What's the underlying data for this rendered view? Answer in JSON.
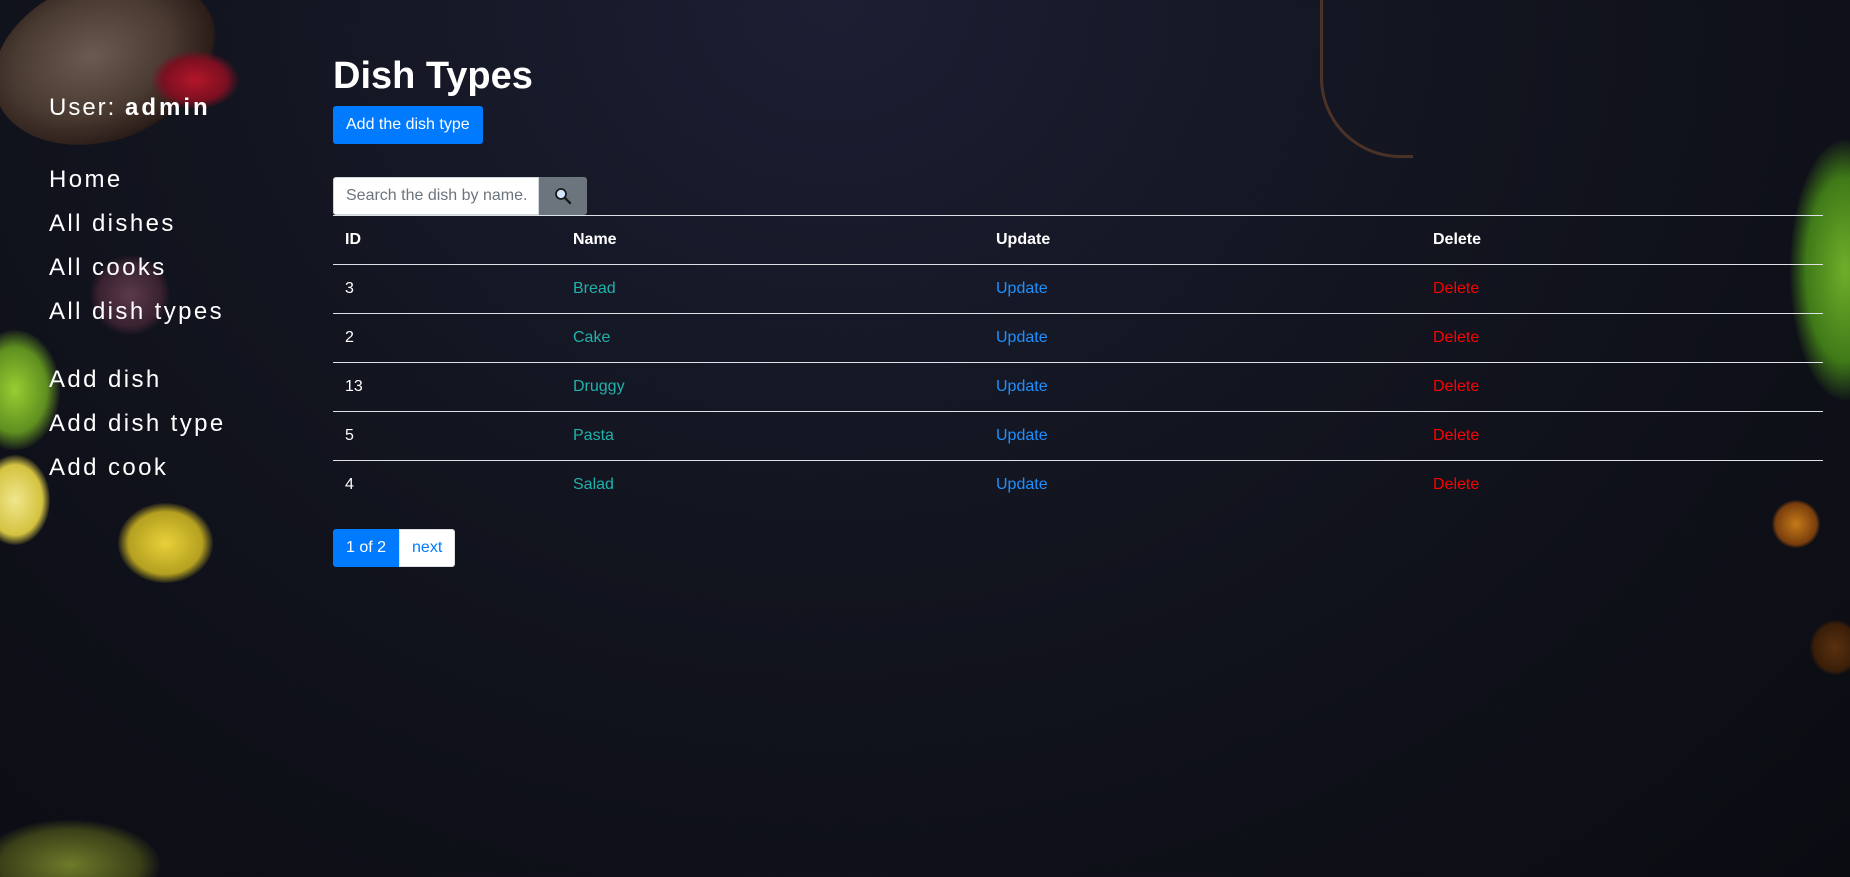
{
  "user": {
    "prefix": "User:",
    "name": "admin"
  },
  "nav": {
    "primary": [
      {
        "label": "Home"
      },
      {
        "label": "All dishes"
      },
      {
        "label": "All cooks"
      },
      {
        "label": "All dish types"
      }
    ],
    "secondary": [
      {
        "label": "Add dish"
      },
      {
        "label": "Add dish type"
      },
      {
        "label": "Add cook"
      }
    ]
  },
  "main": {
    "title": "Dish Types",
    "add_button": "Add the dish type",
    "search": {
      "placeholder": "Search the dish by name..",
      "button_icon": "search-icon"
    }
  },
  "table": {
    "headers": {
      "id": "ID",
      "name": "Name",
      "update": "Update",
      "delete": "Delete"
    },
    "rows": [
      {
        "id": "3",
        "name": "Bread",
        "update": "Update",
        "delete": "Delete"
      },
      {
        "id": "2",
        "name": "Cake",
        "update": "Update",
        "delete": "Delete"
      },
      {
        "id": "13",
        "name": "Druggy",
        "update": "Update",
        "delete": "Delete"
      },
      {
        "id": "5",
        "name": "Pasta",
        "update": "Update",
        "delete": "Delete"
      },
      {
        "id": "4",
        "name": "Salad",
        "update": "Update",
        "delete": "Delete"
      }
    ]
  },
  "pagination": {
    "current": "1 of 2",
    "next": "next"
  },
  "colors": {
    "primary": "#007bff",
    "name_link": "#20b2aa",
    "update_link": "#1e90ff",
    "delete_link": "#ff0000",
    "background": "#12141f"
  }
}
